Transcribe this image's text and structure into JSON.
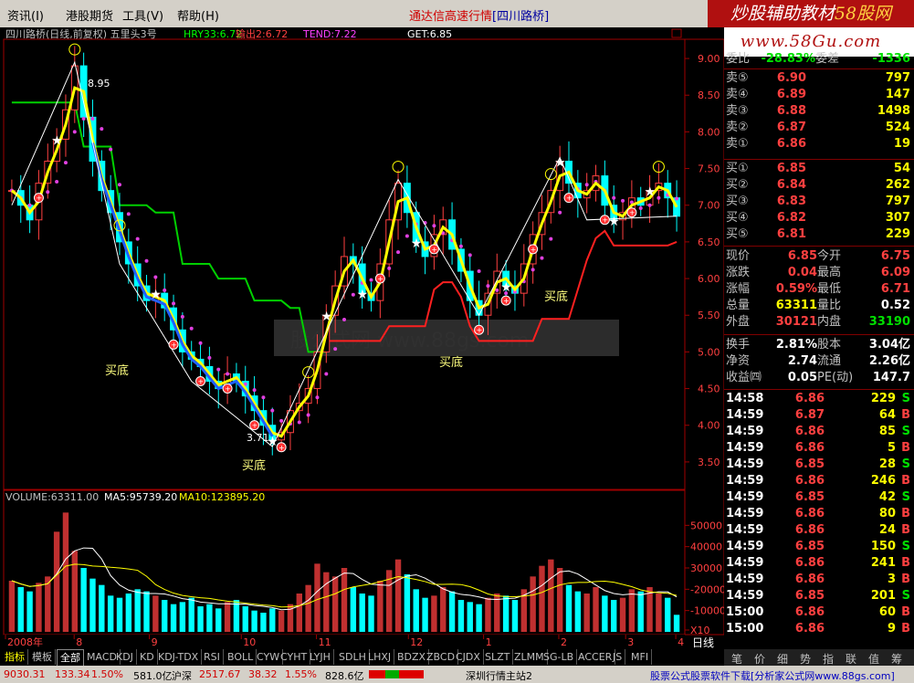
{
  "menu": {
    "items": [
      "资讯(I)",
      "港股期货",
      "工具(V)",
      "帮助(H)"
    ],
    "center_title": "通达信高速行情",
    "center_sub": "[四川路桥]"
  },
  "brand": {
    "line1_a": "炒股辅助教材",
    "line1_b": "58股网",
    "line2": "www.58Gu.com"
  },
  "chart": {
    "header": "四川路桥(日线,前复权) 五里头3号",
    "hry": "HRY33:6.72",
    "sell": "输出2:6.72",
    "tend": "TEND:7.22",
    "get": "GET:6.85",
    "y_ticks": [
      "9.00",
      "8.50",
      "8.00",
      "7.50",
      "7.00",
      "6.50",
      "6.00",
      "5.50",
      "5.00",
      "4.50",
      "4.00",
      "3.50"
    ],
    "high_label": "8.95",
    "low_label": "3.71",
    "buy_labels": [
      "买底",
      "买底",
      "买底",
      "买底"
    ],
    "watermark": "股公式网 www.88gs.com",
    "volume_header": {
      "label": "VOLUME:63311.00",
      "ma5": "MA5:95739.20",
      "ma10": "MA10:123895.20"
    },
    "vol_ticks": [
      "50000",
      "40000",
      "30000",
      "-20000",
      "-10000",
      "X10"
    ],
    "x_labels": [
      "2008年",
      "8",
      "9",
      "10",
      "11",
      "12",
      "1",
      "2",
      "3",
      "4"
    ],
    "period": "日线"
  },
  "chart_data": {
    "type": "bar",
    "title": "",
    "price_ylim": [
      3.2,
      9.2
    ],
    "volume_ylim": [
      0,
      60000
    ],
    "close": [
      7.2,
      7.0,
      6.8,
      7.3,
      7.6,
      7.9,
      8.3,
      8.9,
      8.2,
      7.6,
      7.2,
      6.9,
      6.5,
      6.2,
      5.9,
      5.7,
      5.8,
      5.6,
      5.3,
      5.0,
      4.9,
      4.8,
      4.6,
      4.5,
      4.7,
      4.6,
      4.4,
      4.2,
      4.0,
      3.8,
      3.9,
      4.2,
      4.3,
      4.5,
      5.0,
      5.5,
      5.9,
      6.3,
      6.2,
      5.8,
      5.7,
      6.2,
      6.8,
      7.3,
      6.9,
      6.5,
      6.3,
      6.6,
      6.8,
      6.4,
      6.1,
      5.7,
      5.5,
      5.8,
      6.1,
      5.9,
      5.8,
      6.2,
      6.6,
      6.9,
      7.2,
      7.6,
      7.3,
      7.1,
      7.2,
      7.4,
      7.0,
      6.8,
      6.9,
      7.1,
      7.0,
      7.2,
      7.3,
      7.1,
      6.85
    ],
    "volume": [
      24000,
      21000,
      19000,
      23000,
      26000,
      47000,
      56000,
      38000,
      30000,
      25000,
      22000,
      17000,
      16000,
      18000,
      20000,
      19000,
      17000,
      15000,
      13000,
      14000,
      16000,
      12000,
      13000,
      11000,
      14000,
      15000,
      12000,
      10000,
      9000,
      11000,
      10000,
      13000,
      18000,
      22000,
      32000,
      28000,
      26000,
      30000,
      21000,
      18000,
      17000,
      24000,
      29000,
      34000,
      27000,
      20000,
      16000,
      17000,
      21000,
      19000,
      15000,
      14000,
      13000,
      16000,
      18000,
      17000,
      15000,
      20000,
      26000,
      31000,
      34000,
      30000,
      22000,
      19000,
      18000,
      21000,
      17000,
      15000,
      16000,
      20000,
      19000,
      21000,
      18000,
      16000,
      8000
    ]
  },
  "quote": {
    "wei_bi": {
      "l1": "委比",
      "v1": "-28.83%",
      "l2": "委差",
      "v2": "-1336"
    },
    "sell": [
      {
        "l": "卖⑤",
        "p": "6.90",
        "v": "797"
      },
      {
        "l": "卖④",
        "p": "6.89",
        "v": "147"
      },
      {
        "l": "卖③",
        "p": "6.88",
        "v": "1498"
      },
      {
        "l": "卖②",
        "p": "6.87",
        "v": "524"
      },
      {
        "l": "卖①",
        "p": "6.86",
        "v": "19"
      }
    ],
    "buy": [
      {
        "l": "买①",
        "p": "6.85",
        "v": "54"
      },
      {
        "l": "买②",
        "p": "6.84",
        "v": "262"
      },
      {
        "l": "买③",
        "p": "6.83",
        "v": "797"
      },
      {
        "l": "买④",
        "p": "6.82",
        "v": "307"
      },
      {
        "l": "买⑤",
        "p": "6.81",
        "v": "229"
      }
    ],
    "stats": [
      {
        "l1": "现价",
        "v1": "6.85",
        "l2": "今开",
        "v2": "6.75"
      },
      {
        "l1": "涨跌",
        "v1": "0.04",
        "l2": "最高",
        "v2": "6.09"
      },
      {
        "l1": "涨幅",
        "v1": "0.59%",
        "l2": "最低",
        "v2": "6.71"
      },
      {
        "l1": "总量",
        "v1": "63311",
        "l2": "量比",
        "v2": "0.52"
      },
      {
        "l1": "外盘",
        "v1": "30121",
        "l2": "内盘",
        "v2": "33190"
      }
    ],
    "stats2": [
      {
        "l1": "换手",
        "v1": "2.81%",
        "l2": "股本",
        "v2": "3.04亿"
      },
      {
        "l1": "净资",
        "v1": "2.74",
        "l2": "流通",
        "v2": "2.26亿"
      },
      {
        "l1": "收益㈣",
        "v1": "0.05",
        "l2": "PE(动)",
        "v2": "147.7"
      }
    ],
    "ticks": [
      {
        "t": "14:58",
        "p": "6.86",
        "v": "229",
        "s": "S"
      },
      {
        "t": "14:59",
        "p": "6.87",
        "v": "64",
        "s": "B"
      },
      {
        "t": "14:59",
        "p": "6.86",
        "v": "85",
        "s": "S"
      },
      {
        "t": "14:59",
        "p": "6.86",
        "v": "5",
        "s": "B"
      },
      {
        "t": "14:59",
        "p": "6.85",
        "v": "28",
        "s": "S"
      },
      {
        "t": "14:59",
        "p": "6.86",
        "v": "246",
        "s": "B"
      },
      {
        "t": "14:59",
        "p": "6.85",
        "v": "42",
        "s": "S"
      },
      {
        "t": "14:59",
        "p": "6.86",
        "v": "80",
        "s": "B"
      },
      {
        "t": "14:59",
        "p": "6.86",
        "v": "24",
        "s": "B"
      },
      {
        "t": "14:59",
        "p": "6.85",
        "v": "150",
        "s": "S"
      },
      {
        "t": "14:59",
        "p": "6.86",
        "v": "241",
        "s": "B"
      },
      {
        "t": "14:59",
        "p": "6.86",
        "v": "3",
        "s": "B"
      },
      {
        "t": "14:59",
        "p": "6.85",
        "v": "201",
        "s": "S"
      },
      {
        "t": "15:00",
        "p": "6.86",
        "v": "60",
        "s": "B"
      },
      {
        "t": "15:00",
        "p": "6.86",
        "v": "9",
        "s": "B"
      }
    ]
  },
  "tabs": [
    "指标",
    "模板",
    "全部",
    "MACD",
    "KDJ",
    "KD",
    "KDJ-TDX",
    "RSI",
    "BOLL",
    "CYW",
    "CYHT",
    "LYJH",
    "SDLH",
    "LHXJ",
    "BDZX",
    "ZBCD",
    "CJDX",
    "SLZT",
    "ZLMM",
    "SG-LB",
    "ACCER",
    "JS",
    "MFI"
  ],
  "right_tabs": [
    "笔",
    "价",
    "细",
    "势",
    "指",
    "联",
    "值",
    "筹"
  ],
  "status": {
    "index1": "9030.31",
    "chg1": "133.34",
    "pct1": "1.50%",
    "amt1": "581.0亿",
    "name2": "沪深",
    "index2": "2517.67",
    "chg2": "38.32",
    "pct2": "1.55%",
    "amt2": "828.6亿",
    "market": "深圳行情主站2",
    "ad": "股票公式股票软件下载[分析家公式网www.88gs.com]"
  },
  "colors": {
    "up": "#ff4040",
    "down": "#00ffff",
    "ma_yellow": "#ffff00",
    "ma_blue": "#2060ff",
    "stop_green": "#00d000",
    "dots": "#e040e0"
  }
}
